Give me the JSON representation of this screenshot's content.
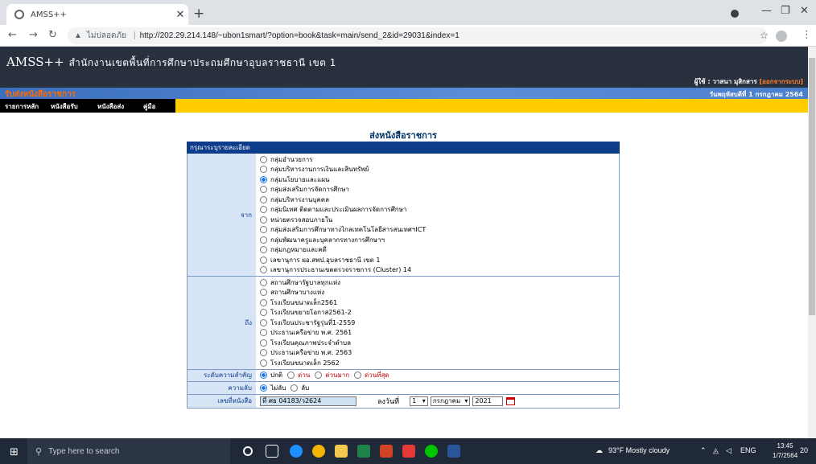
{
  "browser": {
    "tab_title": "AMSS++",
    "url_security": "ไม่ปลอดภัย",
    "url": "http://202.29.214.148/~ubon1smart/?option=book&task=main/send_2&id=29031&index=1"
  },
  "header": {
    "brand": "AMSS++",
    "office": "สำนักงานเขตพื้นที่การศึกษาประถมศึกษาอุบลราชธานี เขต 1",
    "user_label": "ผู้ใช้ : วาสนา มุสิกสาร",
    "logout": "[ออกจากระบบ]"
  },
  "subheader": {
    "title": "รับส่งหนังสือราชการ",
    "date": "วันพฤหัสบดีที่ 1 กรกฎาคม 2564"
  },
  "menu": [
    "รายการหลัก",
    "หนังสือรับ",
    "หนังสือส่ง",
    "คู่มือ"
  ],
  "form": {
    "title": "ส่งหนังสือราชการ",
    "caption": "กรุณาระบุรายละเอียด",
    "from_label": "จาก",
    "from_options": [
      {
        "label": "กลุ่มอำนวยการ",
        "checked": false
      },
      {
        "label": "กลุ่มบริหารงานการเงินและสินทรัพย์",
        "checked": false
      },
      {
        "label": "กลุ่มนโยบายและแผน",
        "checked": true
      },
      {
        "label": "กลุ่มส่งเสริมการจัดการศึกษา",
        "checked": false
      },
      {
        "label": "กลุ่มบริหารงานบุคคล",
        "checked": false
      },
      {
        "label": "กลุ่มนิเทศ ติดตามและประเมินผลการจัดการศึกษา",
        "checked": false
      },
      {
        "label": "หน่วยตรวจสอบภายใน",
        "checked": false
      },
      {
        "label": "กลุ่มส่งเสริมการศึกษาทางไกลเทคโนโลยีสารสนเทศฯICT",
        "checked": false
      },
      {
        "label": "กลุ่มพัฒนาครูและบุคลากรทางการศึกษาฯ",
        "checked": false
      },
      {
        "label": "กลุ่มกฎหมายและคดี",
        "checked": false
      },
      {
        "label": "เลขานุการ ผอ.สพป.อุบลราชธานี เขต 1",
        "checked": false
      },
      {
        "label": "เลขานุการประธานเขตตรวจราชการ (Cluster) 14",
        "checked": false
      }
    ],
    "to_label": "ถึง",
    "to_options": [
      {
        "label": "สถานศึกษารัฐบาลทุกแห่ง",
        "checked": false
      },
      {
        "label": "สถานศึกษาบางแห่ง",
        "checked": false
      },
      {
        "label": "โรงเรียนขนาดเล็ก2561",
        "checked": false
      },
      {
        "label": "โรงเรียนขยายโอกาส2561-2",
        "checked": false
      },
      {
        "label": "โรงเรียนประชารัฐรุ่นที่1-2559",
        "checked": false
      },
      {
        "label": "ประธานเครือข่าย พ.ศ. 2561",
        "checked": false
      },
      {
        "label": "โรงเรียนคุณภาพประจำตำบล",
        "checked": false
      },
      {
        "label": "ประธานเครือข่าย พ.ศ. 2563",
        "checked": false
      },
      {
        "label": "โรงเรียนขนาดเล็ก 2562",
        "checked": false
      }
    ],
    "priority_label": "ระดับความสำคัญ",
    "priority_options": [
      {
        "label": "ปกติ",
        "checked": true,
        "red": false
      },
      {
        "label": "ด่วน",
        "checked": false,
        "red": true
      },
      {
        "label": "ด่วนมาก",
        "checked": false,
        "red": true
      },
      {
        "label": "ด่วนที่สุด",
        "checked": false,
        "red": true
      }
    ],
    "secret_label": "ความลับ",
    "secret_options": [
      {
        "label": "ไม่ลับ",
        "checked": true
      },
      {
        "label": "ลับ",
        "checked": false
      }
    ],
    "docno_label": "เลขที่หนังสือ",
    "docno_value": "ที่ ศธ 04183/ว2624",
    "date_label": "ลงวันที่",
    "day": "1",
    "month": "กรกฎาคม",
    "year": "2021"
  },
  "taskbar": {
    "search_placeholder": "Type here to search",
    "weather": "93°F  Mostly cloudy",
    "lang": "ENG",
    "time": "13:45",
    "date": "1/7/2564",
    "notifications": "20"
  }
}
